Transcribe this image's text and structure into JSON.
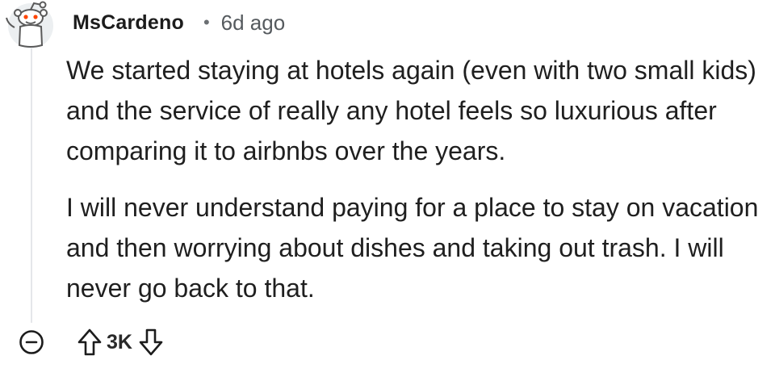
{
  "comment": {
    "avatar_icon": "reddit-snoo-avatar-icon",
    "username": "MsCardeno",
    "separator": "•",
    "timestamp": "6d ago",
    "paragraphs": [
      "We started staying at hotels again (even with two small kids) and the service of really any hotel feels so luxurious after comparing it to airbnbs over the years.",
      "I will never understand paying for a place to stay on vacation and then worrying about dishes and taking out trash. I will never go back to that."
    ],
    "actions": {
      "collapse_icon": "minus-circle-icon",
      "upvote_icon": "arrow-up-icon",
      "vote_count": "3K",
      "downvote_icon": "arrow-down-icon"
    }
  },
  "colors": {
    "text": "#1c1c1c",
    "meta": "#555a5e",
    "snoo_accent": "#ff4500",
    "thread_line": "#e5e7ea"
  }
}
